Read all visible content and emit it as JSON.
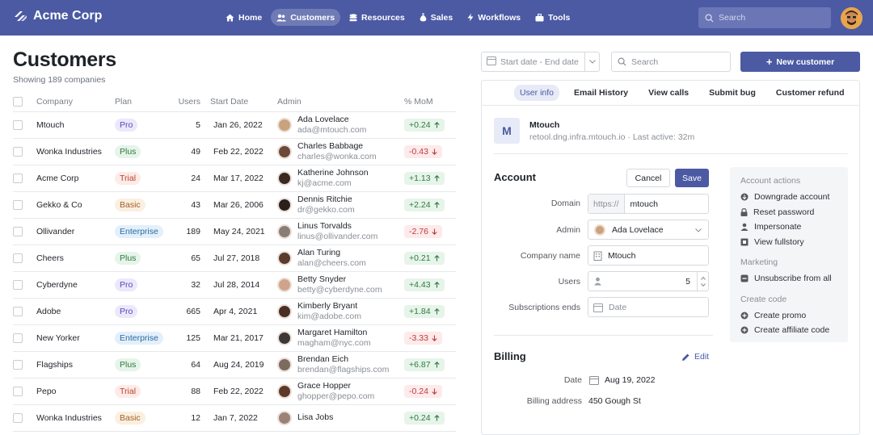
{
  "app": {
    "brand": "Acme Corp"
  },
  "nav": [
    {
      "label": "Home",
      "icon": "home-icon",
      "active": false
    },
    {
      "label": "Customers",
      "icon": "people-icon",
      "active": true
    },
    {
      "label": "Resources",
      "icon": "database-icon",
      "active": false
    },
    {
      "label": "Sales",
      "icon": "money-bag-icon",
      "active": false
    },
    {
      "label": "Workflows",
      "icon": "bolt-icon",
      "active": false
    },
    {
      "label": "Tools",
      "icon": "toolbox-icon",
      "active": false
    }
  ],
  "top_search": {
    "placeholder": "Search"
  },
  "page": {
    "title": "Customers",
    "subtitle": "Showing 189 companies"
  },
  "table": {
    "headers": {
      "company": "Company",
      "plan": "Plan",
      "users": "Users",
      "start": "Start Date",
      "admin": "Admin",
      "mom": "% MoM"
    },
    "rows": [
      {
        "company": "Mtouch",
        "plan": "Pro",
        "users": "5",
        "start": "Jan 26, 2022",
        "admin": "Ada Lovelace",
        "email": "ada@mtouch.com",
        "mom": "+0.24",
        "trend": "up",
        "avatar": "#c9a27e"
      },
      {
        "company": "Wonka Industries",
        "plan": "Plus",
        "users": "49",
        "start": "Feb 22, 2022",
        "admin": "Charles Babbage",
        "email": "charles@wonka.com",
        "mom": "-0.43",
        "trend": "down",
        "avatar": "#6b4a3a"
      },
      {
        "company": "Acme Corp",
        "plan": "Trial",
        "users": "24",
        "start": "Mar 17, 2022",
        "admin": "Katherine Johnson",
        "email": "kj@acme.com",
        "mom": "+1.13",
        "trend": "up",
        "avatar": "#3b2a22"
      },
      {
        "company": "Gekko & Co",
        "plan": "Basic",
        "users": "43",
        "start": "Mar 26, 2006",
        "admin": "Dennis Ritchie",
        "email": "dr@gekko.com",
        "mom": "+2.24",
        "trend": "up",
        "avatar": "#2a211c"
      },
      {
        "company": "Ollivander",
        "plan": "Enterprise",
        "users": "189",
        "start": "May 24, 2021",
        "admin": "Linus Torvalds",
        "email": "linus@ollivander.com",
        "mom": "-2.76",
        "trend": "down",
        "avatar": "#8a7d74"
      },
      {
        "company": "Cheers",
        "plan": "Plus",
        "users": "65",
        "start": "Jul 27, 2018",
        "admin": "Alan Turing",
        "email": "alan@cheers.com",
        "mom": "+0.21",
        "trend": "up",
        "avatar": "#5a3b2d"
      },
      {
        "company": "Cyberdyne",
        "plan": "Pro",
        "users": "32",
        "start": "Jul 28, 2014",
        "admin": "Betty Snyder",
        "email": "betty@cyberdyne.com",
        "mom": "+4.43",
        "trend": "up",
        "avatar": "#d0a48a"
      },
      {
        "company": "Adobe",
        "plan": "Pro",
        "users": "665",
        "start": "Apr 4, 2021",
        "admin": "Kimberly Bryant",
        "email": "kim@adobe.com",
        "mom": "+1.84",
        "trend": "up",
        "avatar": "#4a2f24"
      },
      {
        "company": "New Yorker",
        "plan": "Enterprise",
        "users": "125",
        "start": "Mar 21, 2017",
        "admin": "Margaret Hamilton",
        "email": "magham@nyc.com",
        "mom": "-3.33",
        "trend": "down",
        "avatar": "#3d3835"
      },
      {
        "company": "Flagships",
        "plan": "Plus",
        "users": "64",
        "start": "Aug 24, 2019",
        "admin": "Brendan Eich",
        "email": "brendan@flagships.com",
        "mom": "+6.87",
        "trend": "up",
        "avatar": "#7d6a60"
      },
      {
        "company": "Pepo",
        "plan": "Trial",
        "users": "88",
        "start": "Feb 22, 2022",
        "admin": "Grace Hopper",
        "email": "ghopper@pepo.com",
        "mom": "-0.24",
        "trend": "down",
        "avatar": "#5c3a2a"
      },
      {
        "company": "Wonka Industries",
        "plan": "Basic",
        "users": "12",
        "start": "Jan 7, 2022",
        "admin": "Lisa Jobs",
        "email": "",
        "mom": "+0.24",
        "trend": "up",
        "avatar": "#9a8276"
      }
    ]
  },
  "plan_colors": {
    "Pro": {
      "bg": "#ece8fb",
      "fg": "#5a46b8"
    },
    "Plus": {
      "bg": "#e6f4ea",
      "fg": "#2f7a3e"
    },
    "Trial": {
      "bg": "#fdebe8",
      "fg": "#b8432e"
    },
    "Basic": {
      "bg": "#fbefe0",
      "fg": "#a0612a"
    },
    "Enterprise": {
      "bg": "#e3f0fb",
      "fg": "#2a6aa0"
    }
  },
  "toolbar": {
    "date_placeholder": "Start date - End date",
    "search_placeholder": "Search",
    "new_label": "New customer"
  },
  "detail": {
    "tabs": [
      "User info",
      "Email History",
      "View calls",
      "Submit bug",
      "Customer refund"
    ],
    "company": {
      "logo_letter": "M",
      "name": "Mtouch",
      "meta": "retool.dng.infra.mtouch.io  ·  Last active: 32m"
    },
    "account": {
      "title": "Account",
      "cancel": "Cancel",
      "save": "Save",
      "domain_label": "Domain",
      "domain_prefix": "https://",
      "domain_value": "mtouch",
      "admin_label": "Admin",
      "admin_value": "Ada Lovelace",
      "company_label": "Company name",
      "company_value": "Mtouch",
      "users_label": "Users",
      "users_value": "5",
      "subs_label": "Subscriptions ends",
      "subs_placeholder": "Date"
    },
    "actions": {
      "account_heading": "Account actions",
      "account_items": [
        "Downgrade account",
        "Reset password",
        "Impersonate",
        "View fullstory"
      ],
      "marketing_heading": "Marketing",
      "marketing_items": [
        "Unsubscribe from all"
      ],
      "promo_heading": "Create code",
      "promo_items": [
        "Create promo",
        "Create affiliate code"
      ]
    },
    "billing": {
      "title": "Billing",
      "edit": "Edit",
      "date_label": "Date",
      "date_value": "Aug 19, 2022",
      "address_label": "Billing address",
      "address_value": "450 Gough St"
    }
  }
}
